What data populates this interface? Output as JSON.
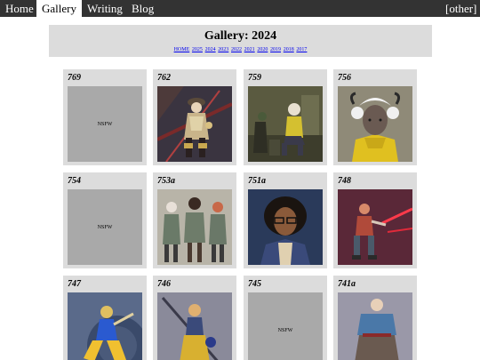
{
  "nav": {
    "items": [
      "Home",
      "Gallery",
      "Writing",
      "Blog"
    ],
    "other": "[other]"
  },
  "header": {
    "title": "Gallery: 2024",
    "year_links": [
      "HOME",
      "2025",
      "2024",
      "2023",
      "2022",
      "2021",
      "2020",
      "2019",
      "2018",
      "2017"
    ]
  },
  "gallery": {
    "nsfw_label": "NSFW",
    "cards": [
      {
        "num": "769",
        "kind": "nsfw",
        "icon": "nsfw-placeholder"
      },
      {
        "num": "762",
        "kind": "image",
        "icon": "armored-figure-artwork"
      },
      {
        "num": "759",
        "kind": "image",
        "icon": "seated-figure-artwork"
      },
      {
        "num": "756",
        "kind": "image",
        "icon": "horned-character-artwork"
      },
      {
        "num": "754",
        "kind": "nsfw",
        "icon": "nsfw-placeholder"
      },
      {
        "num": "753a",
        "kind": "image",
        "icon": "three-figures-artwork"
      },
      {
        "num": "751a",
        "kind": "image",
        "icon": "portrait-glasses-artwork"
      },
      {
        "num": "748",
        "kind": "image",
        "icon": "sword-fighter-artwork"
      },
      {
        "num": "747",
        "kind": "image",
        "icon": "dynamic-pose-artwork"
      },
      {
        "num": "746",
        "kind": "image",
        "icon": "staff-wielder-artwork"
      },
      {
        "num": "745",
        "kind": "nsfw",
        "icon": "nsfw-placeholder"
      },
      {
        "num": "741a",
        "kind": "image",
        "icon": "robed-figure-artwork"
      }
    ]
  },
  "colors": {
    "nav_bg": "#333333",
    "panel_bg": "#dcdcdc",
    "nsfw_bg": "#a9a9a9",
    "link": "#0000ee"
  }
}
